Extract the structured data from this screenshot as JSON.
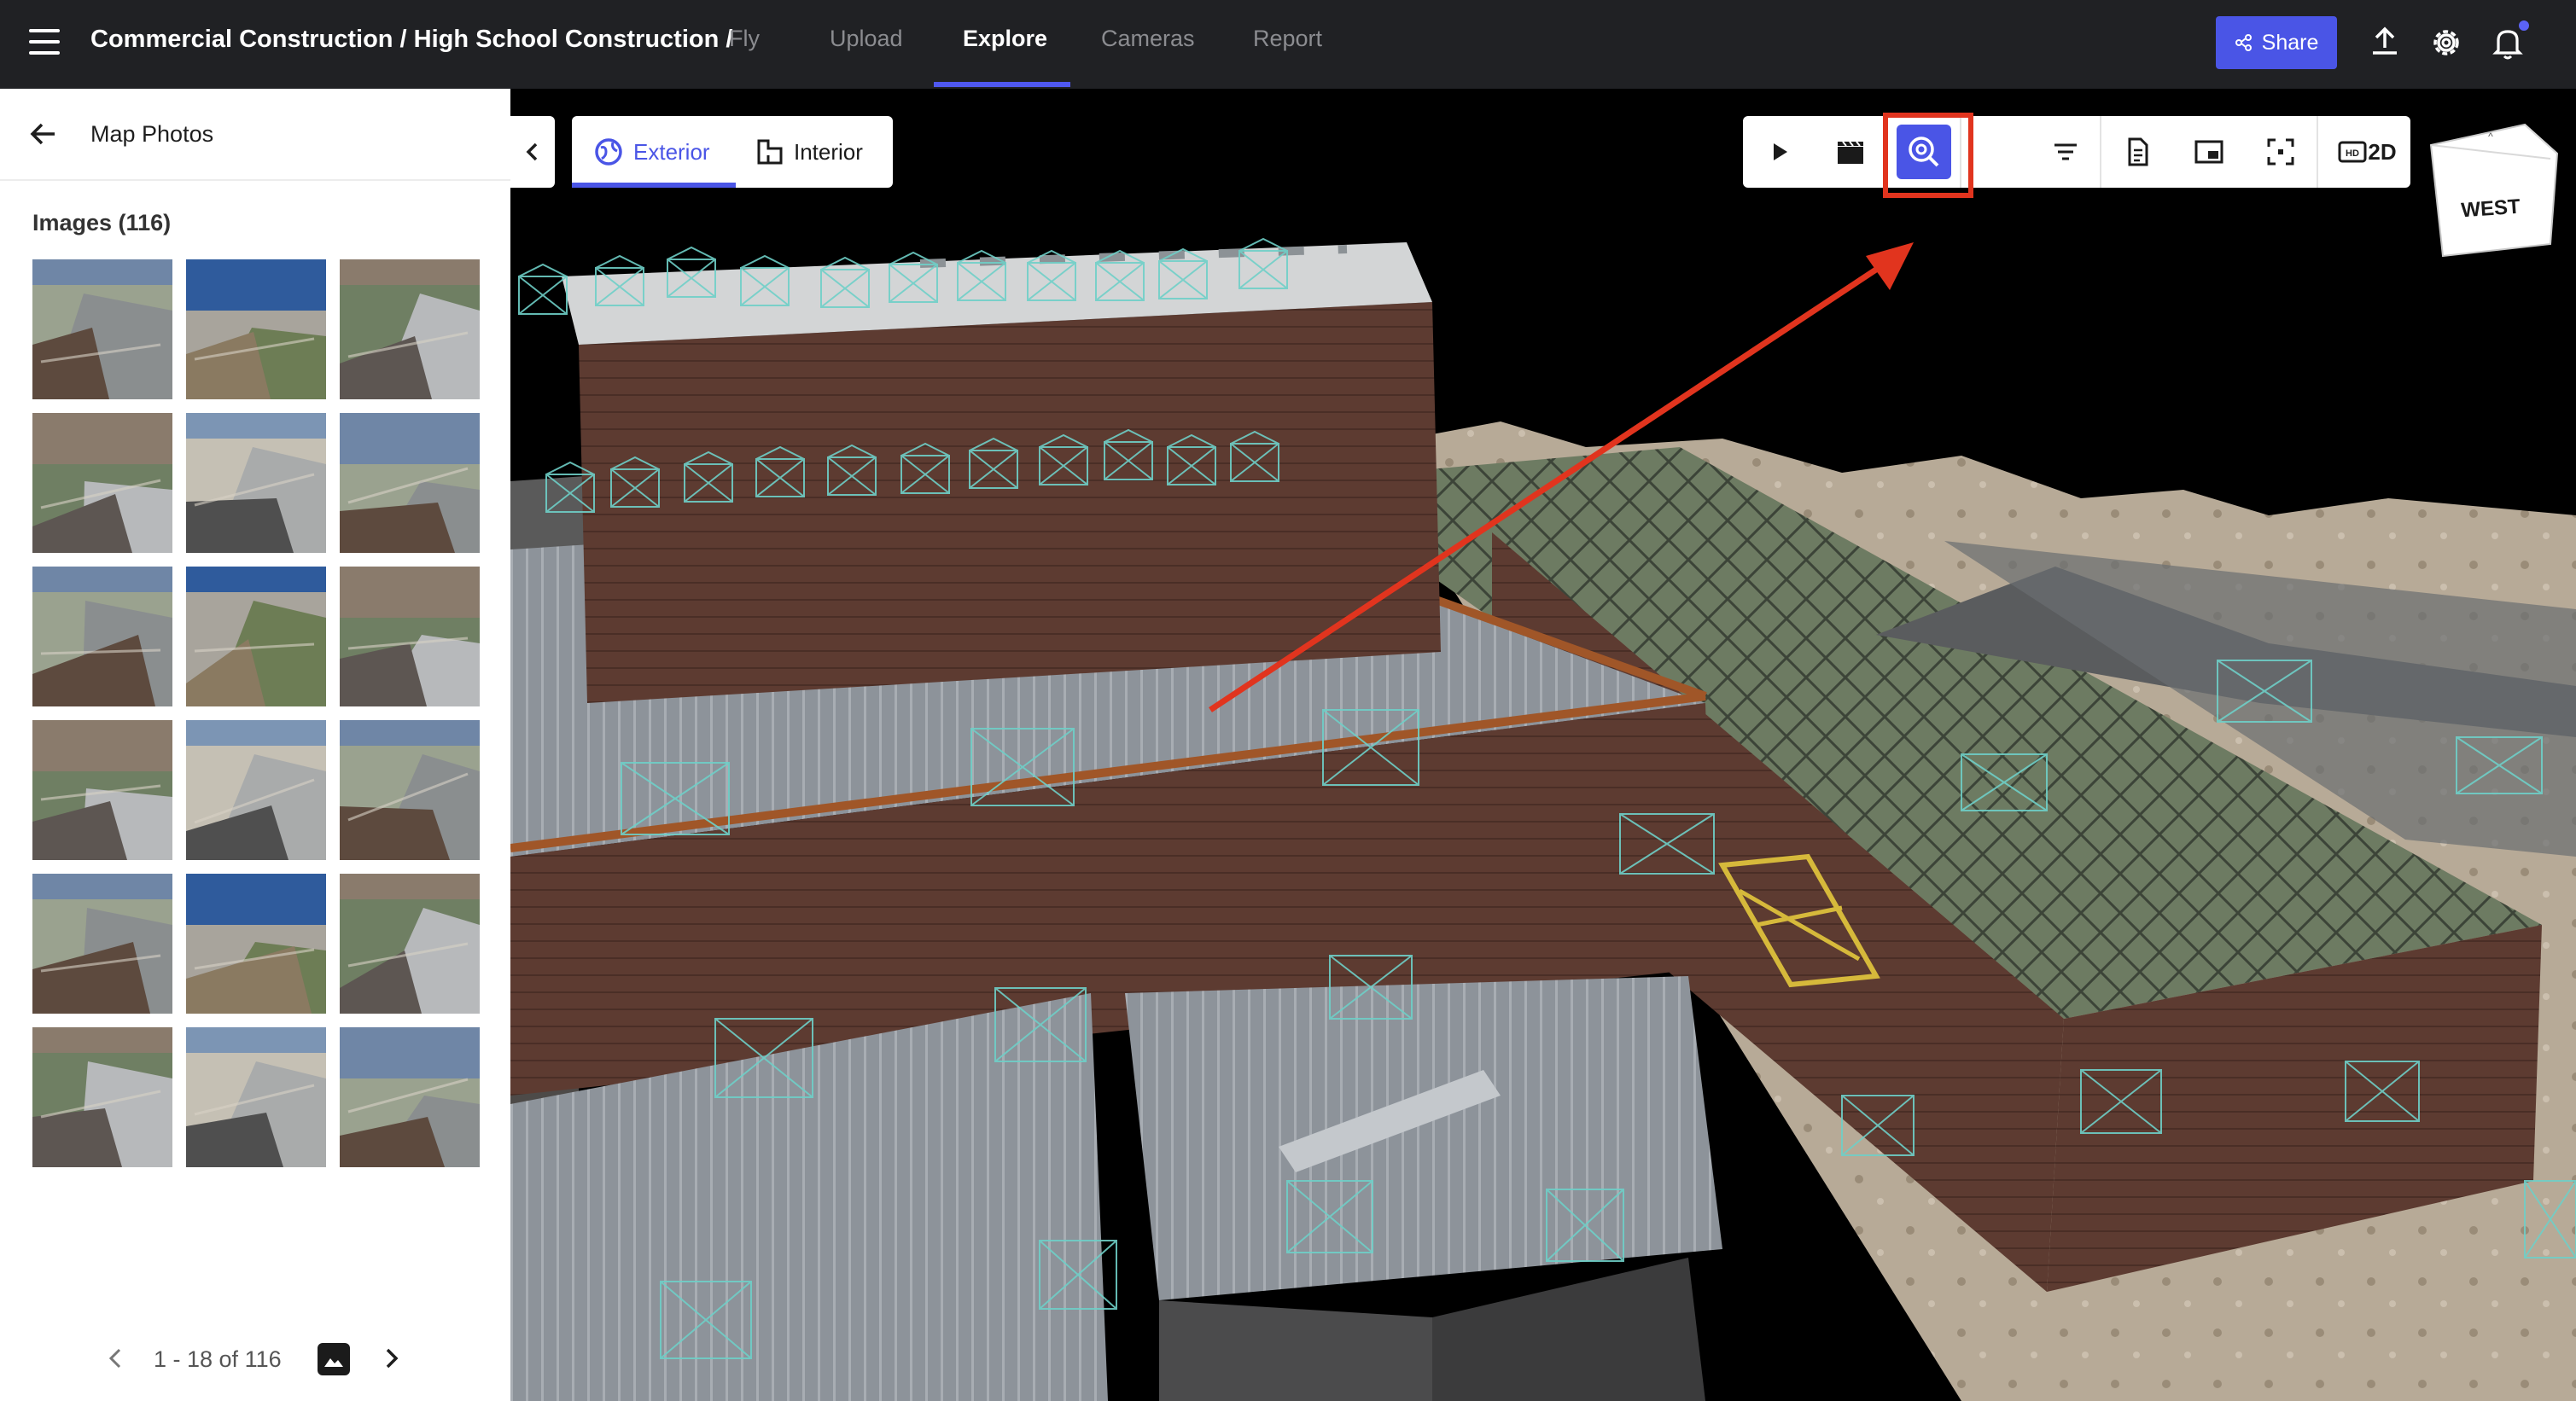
{
  "header": {
    "breadcrumb": "Commercial Construction / High School Construction /",
    "tabs": [
      {
        "label": "Fly",
        "active": false
      },
      {
        "label": "Upload",
        "active": false
      },
      {
        "label": "Explore",
        "active": true
      },
      {
        "label": "Cameras",
        "active": false
      },
      {
        "label": "Report",
        "active": false
      }
    ],
    "share_label": "Share",
    "accent_color": "#4a55e6"
  },
  "panel": {
    "title": "Map Photos",
    "images_count_label": "Images (116)",
    "thumbnails_shown": 18,
    "pager_text": "1 - 18 of 116"
  },
  "viewport": {
    "view_modes": [
      {
        "label": "Exterior",
        "active": true,
        "icon": "globe-icon"
      },
      {
        "label": "Interior",
        "active": false,
        "icon": "floorplan-icon"
      }
    ],
    "toolbar": [
      {
        "name": "play-button",
        "icon": "play-icon"
      },
      {
        "name": "flythrough-button",
        "icon": "clapperboard-icon"
      },
      {
        "name": "inspect-button",
        "icon": "magnify-icon",
        "active": true
      },
      {
        "name": "filter-button",
        "icon": "filter-icon"
      },
      {
        "name": "report-button",
        "icon": "document-icon"
      },
      {
        "name": "minimap-button",
        "icon": "picture-in-picture-icon"
      },
      {
        "name": "fullscreen-button",
        "icon": "fullscreen-icon"
      },
      {
        "name": "hd-button",
        "icon": "hd-icon"
      },
      {
        "name": "2d-button",
        "label": "2D"
      }
    ],
    "compass_label": "WEST",
    "annotation_color": "#e1341e"
  }
}
